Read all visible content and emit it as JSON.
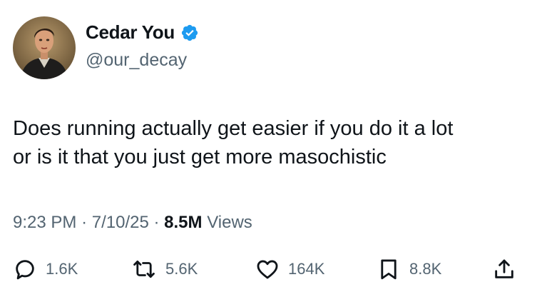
{
  "user": {
    "display_name": "Cedar You",
    "handle": "@our_decay",
    "verified": true
  },
  "tweet": {
    "text_lines": [
      "Does running actually get easier if you do it a lot",
      "or is it that you just get more masochistic"
    ],
    "time": "9:23 PM",
    "date": "7/10/25",
    "views_count": "8.5M",
    "views_label": "Views",
    "separator": "·"
  },
  "actions": {
    "replies": "1.6K",
    "reposts": "5.6K",
    "likes": "164K",
    "bookmarks": "8.8K"
  },
  "colors": {
    "text": "#0f1419",
    "secondary": "#536471",
    "verified": "#1d9bf0"
  }
}
